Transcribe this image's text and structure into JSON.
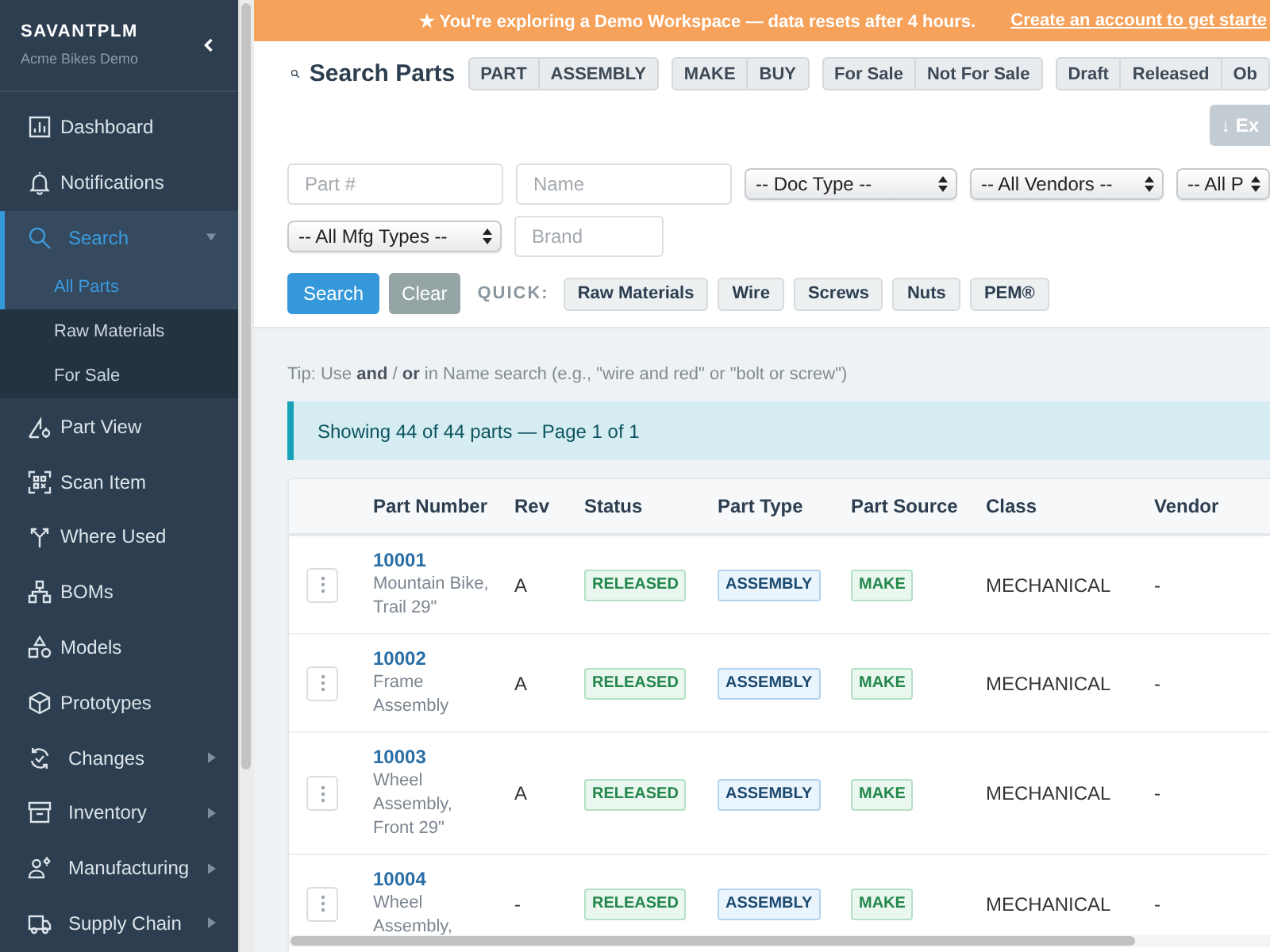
{
  "sidebar": {
    "brand": "SAVANTPLM",
    "subtitle": "Acme Bikes Demo",
    "items": [
      {
        "label": "Dashboard",
        "selected": false
      },
      {
        "label": "Notifications",
        "selected": false
      },
      {
        "label": "Search",
        "selected": true,
        "expanded": true,
        "children": [
          {
            "label": "All Parts",
            "selected": true
          },
          {
            "label": "Raw Materials",
            "selected": false
          },
          {
            "label": "For Sale",
            "selected": false
          }
        ]
      },
      {
        "label": "Part View",
        "selected": false
      },
      {
        "label": "Scan Item",
        "selected": false
      },
      {
        "label": "Where Used",
        "selected": false
      },
      {
        "label": "BOMs",
        "selected": false
      },
      {
        "label": "Models",
        "selected": false
      },
      {
        "label": "Prototypes",
        "selected": false
      },
      {
        "label": "Changes",
        "selected": false,
        "expanded": false
      },
      {
        "label": "Inventory",
        "selected": false,
        "expanded": false
      },
      {
        "label": "Manufacturing",
        "selected": false,
        "expanded": false
      },
      {
        "label": "Supply Chain",
        "selected": false,
        "expanded": false
      }
    ]
  },
  "banner": {
    "text": "★ You're exploring a Demo Workspace — data resets after 4 hours.",
    "link": "Create an account to get starte"
  },
  "header": {
    "title": "Search Parts",
    "toggle_groups": [
      [
        {
          "label": "PART",
          "selected": false
        },
        {
          "label": "ASSEMBLY",
          "selected": false
        }
      ],
      [
        {
          "label": "MAKE",
          "selected": false
        },
        {
          "label": "BUY",
          "selected": false
        }
      ],
      [
        {
          "label": "For Sale",
          "selected": false
        },
        {
          "label": "Not For Sale",
          "selected": false
        }
      ],
      [
        {
          "label": "Draft",
          "selected": false
        },
        {
          "label": "Released",
          "selected": false
        },
        {
          "label": "Ob",
          "selected": false
        }
      ]
    ],
    "export_button": "↓ Ex"
  },
  "filters": [
    [
      {
        "kind": "input",
        "placeholder": "Part #"
      },
      {
        "kind": "input",
        "placeholder": "Name"
      },
      {
        "kind": "select",
        "value": "-- Doc Type --"
      },
      {
        "kind": "select",
        "value": "-- All Vendors --"
      },
      {
        "kind": "select",
        "value": "-- All P"
      }
    ],
    [
      {
        "kind": "select",
        "value": "-- All Mfg Types --"
      },
      {
        "kind": "input",
        "placeholder": "Brand"
      }
    ]
  ],
  "actions": {
    "buttons": [
      {
        "label": "Search",
        "kind": "primary"
      },
      {
        "label": "Clear",
        "kind": "secondary"
      }
    ],
    "quick_label": "QUICK:",
    "quick": [
      "Raw Materials",
      "Wire",
      "Screws",
      "Nuts",
      "PEM®"
    ]
  },
  "tip": "Tip: Use **and** / **or** in Name search (e.g., \"wire and red\" or \"bolt or screw\")",
  "result_info": "Showing 44 of 44 parts — Page 1 of 1",
  "table": {
    "columns": [
      "Part Number",
      "Rev",
      "Status",
      "Part Type",
      "Part Source",
      "Class",
      "Vendor"
    ],
    "rows": [
      {
        "part_number": "10001",
        "description": "Mountain Bike, Trail 29\"",
        "rev": "A",
        "status": "RELEASED",
        "part_type": "ASSEMBLY",
        "part_source": "MAKE",
        "class": "MECHANICAL",
        "vendor": "-"
      },
      {
        "part_number": "10002",
        "description": "Frame Assembly",
        "rev": "A",
        "status": "RELEASED",
        "part_type": "ASSEMBLY",
        "part_source": "MAKE",
        "class": "MECHANICAL",
        "vendor": "-"
      },
      {
        "part_number": "10003",
        "description": "Wheel Assembly, Front 29\"",
        "rev": "A",
        "status": "RELEASED",
        "part_type": "ASSEMBLY",
        "part_source": "MAKE",
        "class": "MECHANICAL",
        "vendor": "-"
      },
      {
        "part_number": "10004",
        "description": "Wheel Assembly,",
        "rev": "-",
        "status": "RELEASED",
        "part_type": "ASSEMBLY",
        "part_source": "MAKE",
        "class": "MECHANICAL",
        "vendor": "-"
      }
    ]
  }
}
